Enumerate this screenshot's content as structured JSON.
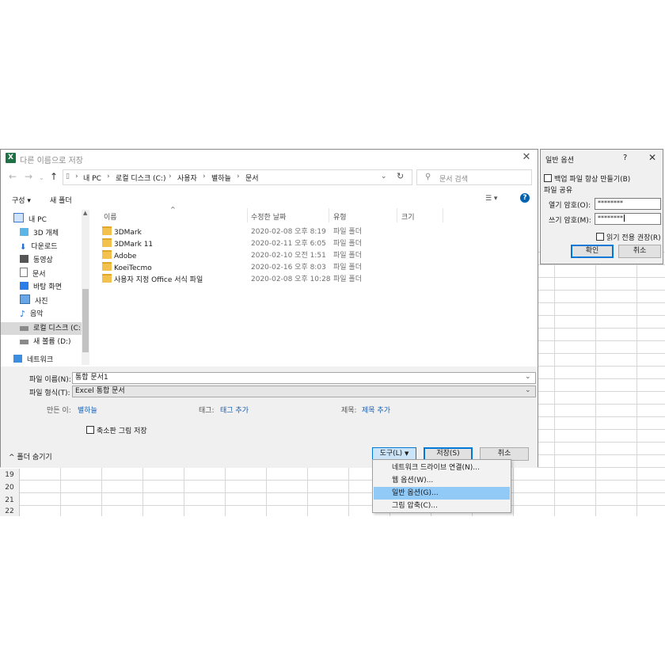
{
  "sheet": {
    "row_numbers": [
      "19",
      "20",
      "21",
      "22"
    ]
  },
  "dialog": {
    "title": "다른 이름으로 저장",
    "address": {
      "crumbs": [
        "내 PC",
        "로컬 디스크 (C:)",
        "사용자",
        "별하늘",
        "문서"
      ]
    },
    "search_placeholder": "문서 검색",
    "toolbar": {
      "organize": "구성",
      "new_folder": "새 폴더"
    },
    "sidebar": [
      {
        "label": "내 PC",
        "icon": "pc-icon"
      },
      {
        "label": "3D 개체",
        "icon": "cube-icon"
      },
      {
        "label": "다운로드",
        "icon": "download-icon"
      },
      {
        "label": "동영상",
        "icon": "video-icon"
      },
      {
        "label": "문서",
        "icon": "document-icon"
      },
      {
        "label": "바탕 화면",
        "icon": "desktop-icon"
      },
      {
        "label": "사진",
        "icon": "picture-icon"
      },
      {
        "label": "음악",
        "icon": "music-icon"
      },
      {
        "label": "로컬 디스크 (C:)",
        "icon": "drive-icon"
      },
      {
        "label": "새 볼륨 (D:)",
        "icon": "drive-icon"
      },
      {
        "label": "네트워크",
        "icon": "network-icon"
      }
    ],
    "columns": [
      "이름",
      "수정한 날짜",
      "유형",
      "크기"
    ],
    "files": [
      {
        "name": "3DMark",
        "date": "2020-02-08 오후 8:19",
        "type": "파일 폴더"
      },
      {
        "name": "3DMark 11",
        "date": "2020-02-11 오후 6:05",
        "type": "파일 폴더"
      },
      {
        "name": "Adobe",
        "date": "2020-02-10 오전 1:51",
        "type": "파일 폴더"
      },
      {
        "name": "KoeiTecmo",
        "date": "2020-02-16 오후 8:03",
        "type": "파일 폴더"
      },
      {
        "name": "사용자 지정 Office 서식 파일",
        "date": "2020-02-08 오후 10:28",
        "type": "파일 폴더"
      }
    ],
    "filename_label": "파일 이름(N):",
    "filename_value": "통합 문서1",
    "filetype_label": "파일 형식(T):",
    "filetype_value": "Excel 통합 문서",
    "author_label": "만든 이:",
    "author_value": "별하늘",
    "tags_label": "태그:",
    "tags_value": "태그 추가",
    "title_label": "제목:",
    "title_value": "제목 추가",
    "thumbnail_label": "축소판 그림 저장",
    "hide_folders": "폴더 숨기기",
    "tools_button": "도구(L)",
    "save_button": "저장(S)",
    "cancel_button": "취소"
  },
  "tools_menu": {
    "items": [
      "네트워크 드라이브 연결(N)...",
      "웹 옵션(W)...",
      "일반 옵션(G)...",
      "그림 압축(C)..."
    ],
    "highlighted_index": 2
  },
  "general_options": {
    "title": "일반 옵션",
    "help": "?",
    "backup_label": "백업 파일 항상 만들기(B)",
    "share_section": "파일 공유",
    "open_pw_label": "열기 암호(O):",
    "open_pw_value": "********",
    "write_pw_label": "쓰기 암호(M):",
    "write_pw_value": "********",
    "readonly_label": "읽기 전용 권장(R)",
    "ok_button": "확인",
    "cancel_button": "취소"
  },
  "colors": {
    "accent": "#0078d7",
    "folder": "#f2c14e",
    "menu_highlight": "#91c9f7",
    "excel": "#1e7145"
  }
}
